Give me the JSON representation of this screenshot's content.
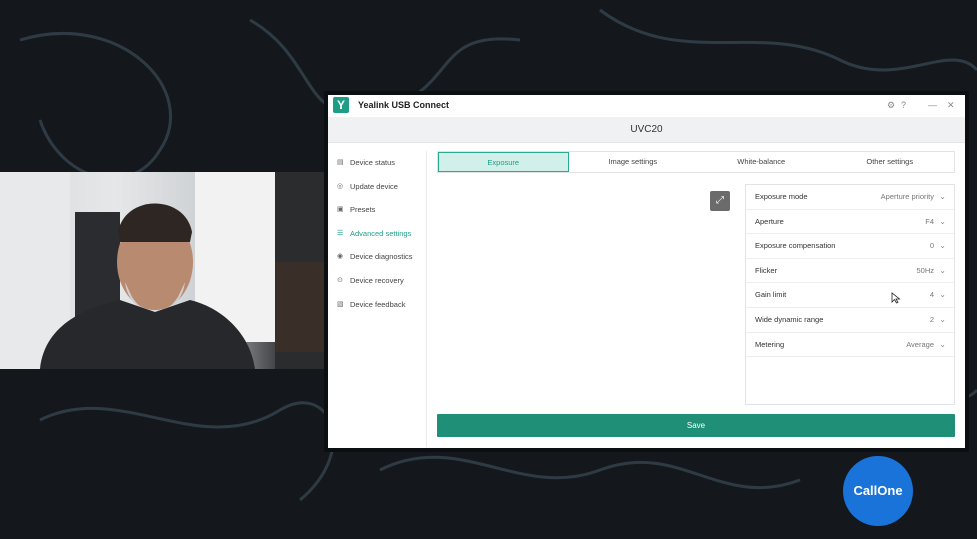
{
  "window": {
    "app_title": "Yealink USB Connect",
    "device_name": "UVC20",
    "settings_icon": "gear-icon",
    "help_icon": "help-icon",
    "minimize_label": "—",
    "close_label": "✕"
  },
  "sidebar": {
    "items": [
      {
        "label": "Device status",
        "icon": "device-status-icon"
      },
      {
        "label": "Update device",
        "icon": "update-icon"
      },
      {
        "label": "Presets",
        "icon": "presets-icon"
      },
      {
        "label": "Advanced settings",
        "icon": "sliders-icon"
      },
      {
        "label": "Device diagnostics",
        "icon": "diagnostics-icon"
      },
      {
        "label": "Device recovery",
        "icon": "recovery-icon"
      },
      {
        "label": "Device feedback",
        "icon": "feedback-icon"
      }
    ],
    "active_index": 3
  },
  "tabs": [
    {
      "label": "Exposure"
    },
    {
      "label": "Image settings"
    },
    {
      "label": "White-balance"
    },
    {
      "label": "Other settings"
    }
  ],
  "exposure_settings": [
    {
      "label": "Exposure mode",
      "value": "Aperture priority"
    },
    {
      "label": "Aperture",
      "value": "F4"
    },
    {
      "label": "Exposure compensation",
      "value": "0"
    },
    {
      "label": "Flicker",
      "value": "50Hz"
    },
    {
      "label": "Gain limit",
      "value": "4"
    },
    {
      "label": "Wide dynamic range",
      "value": "2"
    },
    {
      "label": "Metering",
      "value": "Average"
    }
  ],
  "save_label": "Save",
  "brand_logo": "CallOne",
  "colors": {
    "accent": "#1f9e86",
    "save_button": "#1f9077",
    "active_tab_bg": "#d2f0ea",
    "brand_blue": "#1a73d9"
  }
}
